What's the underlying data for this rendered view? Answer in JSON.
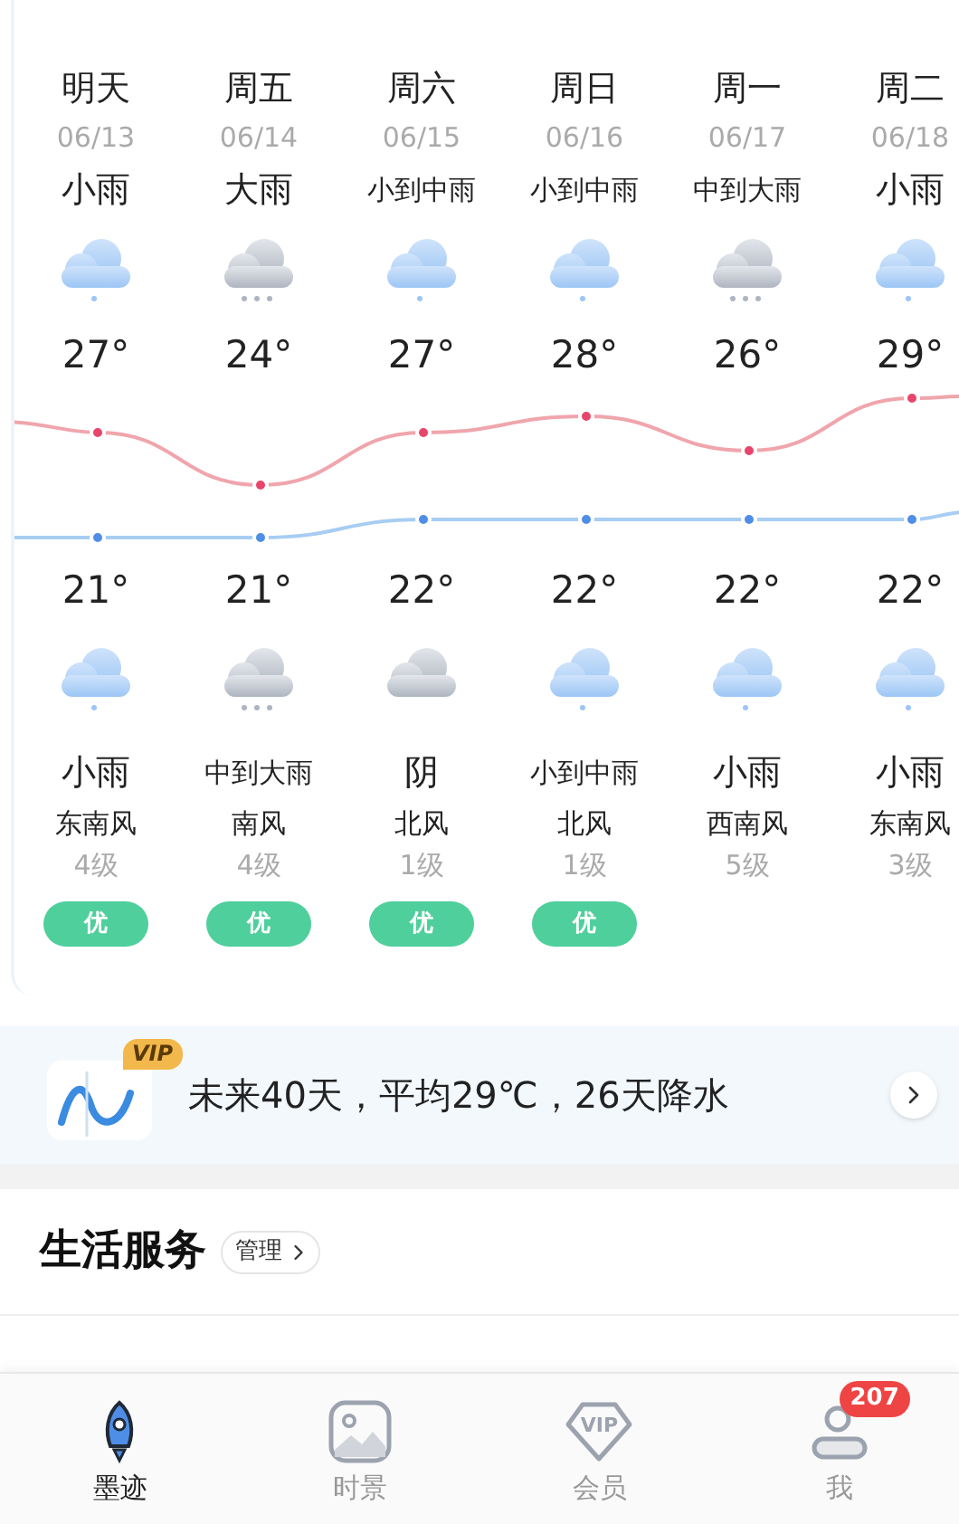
{
  "forecast": [
    {
      "day": "明天",
      "date": "06/13",
      "day_weather": "小雨",
      "day_icon": {
        "kind": "light_rain"
      },
      "high": "27°",
      "low": "21°",
      "night_icon": {
        "kind": "light_rain"
      },
      "night_weather": "小雨",
      "wind": "东南风",
      "wind_level": "4级",
      "aqi": "优"
    },
    {
      "day": "周五",
      "date": "06/14",
      "day_weather": "大雨",
      "day_icon": {
        "kind": "heavy_rain"
      },
      "high": "24°",
      "low": "21°",
      "night_icon": {
        "kind": "heavy_rain"
      },
      "night_weather": "中到大雨",
      "wind": "南风",
      "wind_level": "4级",
      "aqi": "优"
    },
    {
      "day": "周六",
      "date": "06/15",
      "day_weather": "小到中雨",
      "day_icon": {
        "kind": "light_rain"
      },
      "high": "27°",
      "low": "22°",
      "night_icon": {
        "kind": "overcast"
      },
      "night_weather": "阴",
      "wind": "北风",
      "wind_level": "1级",
      "aqi": "优"
    },
    {
      "day": "周日",
      "date": "06/16",
      "day_weather": "小到中雨",
      "day_icon": {
        "kind": "light_rain"
      },
      "high": "28°",
      "low": "22°",
      "night_icon": {
        "kind": "light_rain"
      },
      "night_weather": "小到中雨",
      "wind": "北风",
      "wind_level": "1级",
      "aqi": "优"
    },
    {
      "day": "周一",
      "date": "06/17",
      "day_weather": "中到大雨",
      "day_icon": {
        "kind": "heavy_rain"
      },
      "high": "26°",
      "low": "22°",
      "night_icon": {
        "kind": "light_rain"
      },
      "night_weather": "小雨",
      "wind": "西南风",
      "wind_level": "5级"
    },
    {
      "day": "周二",
      "date": "06/18",
      "day_weather": "小雨",
      "day_icon": {
        "kind": "light_rain"
      },
      "high": "29°",
      "low": "22°",
      "night_icon": {
        "kind": "light_rain"
      },
      "night_weather": "小雨",
      "wind": "东南风",
      "wind_level": "3级"
    }
  ],
  "banner": {
    "badge": "VIP",
    "text": "未来40天，平均29℃，26天降水"
  },
  "services": {
    "title": "生活服务",
    "manage": "管理"
  },
  "nav": [
    {
      "label": "墨迹",
      "selected": true
    },
    {
      "label": "时景",
      "selected": false
    },
    {
      "label": "会员",
      "icon_text": "VIP",
      "selected": false
    },
    {
      "label": "我",
      "badge": "207",
      "selected": false
    }
  ]
}
